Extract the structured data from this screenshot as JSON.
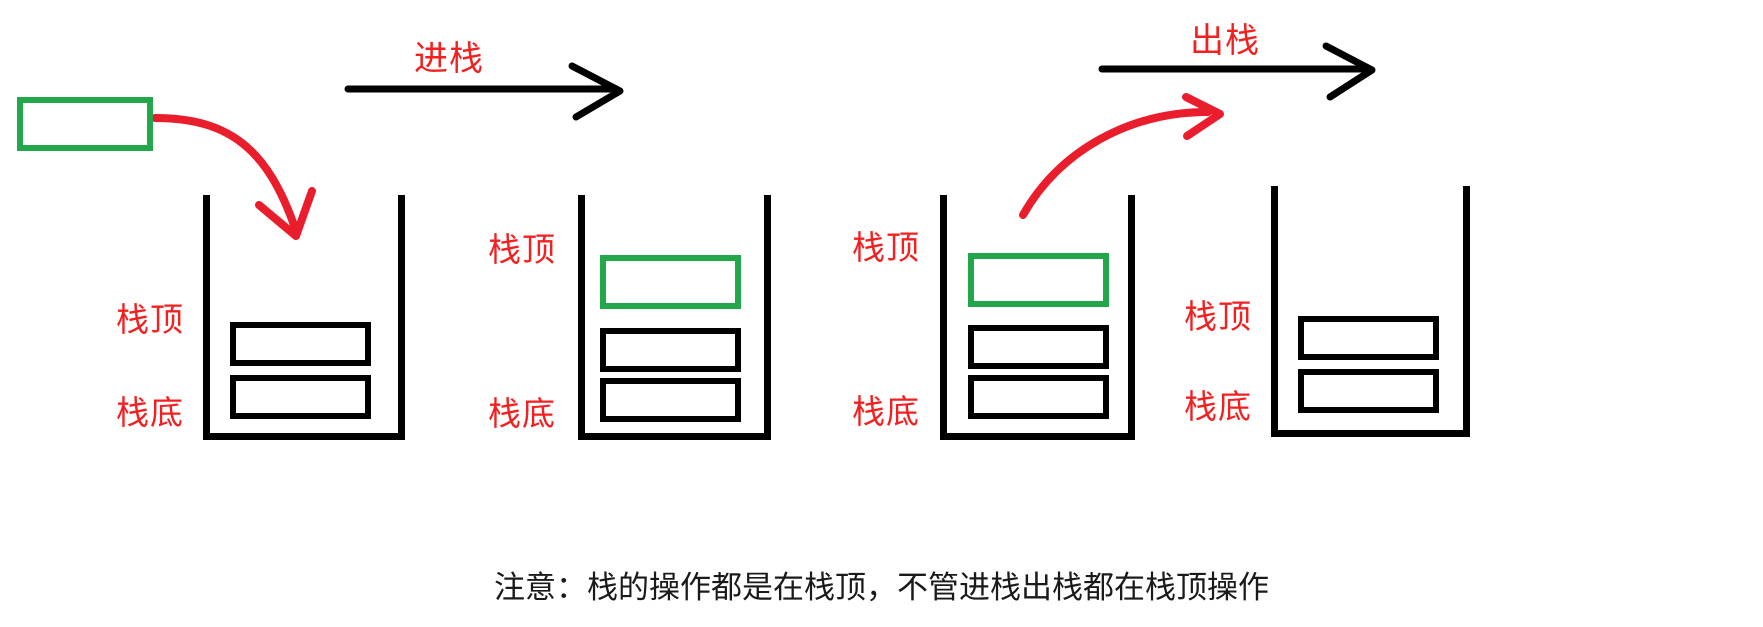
{
  "diagram": {
    "title_caption": "注意：栈的操作都是在栈顶，不管进栈出栈都在栈顶操作",
    "colors": {
      "annotation_red": "#f22020",
      "element_green": "#22a74a",
      "structure_black": "#000000",
      "background": "#ffffff"
    },
    "operations": [
      {
        "label": "进栈",
        "meaning": "push"
      },
      {
        "label": "出栈",
        "meaning": "pop"
      }
    ],
    "stages": [
      {
        "name": "before-push",
        "labels": {
          "top": "栈顶",
          "bottom": "栈底"
        },
        "cells": [
          {
            "color": "black",
            "position": "top"
          },
          {
            "color": "black",
            "position": "bottom"
          }
        ],
        "incoming_element": {
          "color": "green"
        }
      },
      {
        "name": "after-push",
        "labels": {
          "top": "栈顶",
          "bottom": "栈底"
        },
        "cells": [
          {
            "color": "green",
            "position": "top"
          },
          {
            "color": "black",
            "position": "middle"
          },
          {
            "color": "black",
            "position": "bottom"
          }
        ]
      },
      {
        "name": "before-pop",
        "labels": {
          "top": "栈顶",
          "bottom": "栈底"
        },
        "cells": [
          {
            "color": "green",
            "position": "top"
          },
          {
            "color": "black",
            "position": "middle"
          },
          {
            "color": "black",
            "position": "bottom"
          }
        ]
      },
      {
        "name": "after-pop",
        "labels": {
          "top": "栈顶",
          "bottom": "栈底"
        },
        "cells": [
          {
            "color": "black",
            "position": "top"
          },
          {
            "color": "black",
            "position": "bottom"
          }
        ]
      }
    ]
  }
}
